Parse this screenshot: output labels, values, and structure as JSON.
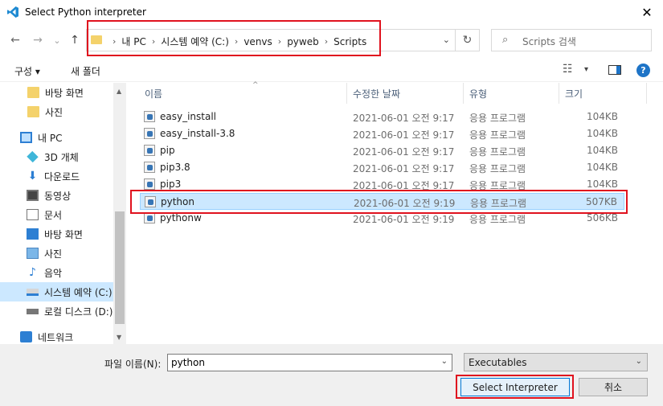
{
  "window": {
    "title": "Select Python interpreter",
    "close_glyph": "✕"
  },
  "nav": {
    "back": "←",
    "forward": "→",
    "recent": "⌄",
    "up": "↑"
  },
  "address": {
    "segments": [
      "내 PC",
      "시스템 예약 (C:)",
      "venvs",
      "pyweb",
      "Scripts"
    ],
    "separator": "›",
    "dropdown": "⌄",
    "refresh": "↻"
  },
  "search": {
    "placeholder": "Scripts 검색",
    "icon": "⌕"
  },
  "toolbar": {
    "organize": "구성 ▾",
    "new_folder": "새 폴더",
    "view_glyph": "☷",
    "view_dd": "▾",
    "help": "?"
  },
  "sidebar": {
    "items": [
      {
        "label": "바탕 화면",
        "icon": "folder"
      },
      {
        "label": "사진",
        "icon": "folder"
      },
      {
        "label": "내 PC",
        "icon": "pc"
      },
      {
        "label": "3D 개체",
        "icon": "3d"
      },
      {
        "label": "다운로드",
        "icon": "download"
      },
      {
        "label": "동영상",
        "icon": "video"
      },
      {
        "label": "문서",
        "icon": "document"
      },
      {
        "label": "바탕 화면",
        "icon": "desktop"
      },
      {
        "label": "사진",
        "icon": "pictures"
      },
      {
        "label": "음악",
        "icon": "music"
      },
      {
        "label": "시스템 예약 (C:)",
        "icon": "drive"
      },
      {
        "label": "로컬 디스크 (D:)",
        "icon": "drive2"
      },
      {
        "label": "네트워크",
        "icon": "network"
      }
    ]
  },
  "columns": {
    "name": "이름",
    "date": "수정한 날짜",
    "type": "유형",
    "size": "크기",
    "sort_arrow": "^"
  },
  "files": [
    {
      "name": "easy_install",
      "date": "2021-06-01 오전 9:17",
      "type": "응용 프로그램",
      "size": "104KB"
    },
    {
      "name": "easy_install-3.8",
      "date": "2021-06-01 오전 9:17",
      "type": "응용 프로그램",
      "size": "104KB"
    },
    {
      "name": "pip",
      "date": "2021-06-01 오전 9:17",
      "type": "응용 프로그램",
      "size": "104KB"
    },
    {
      "name": "pip3.8",
      "date": "2021-06-01 오전 9:17",
      "type": "응용 프로그램",
      "size": "104KB"
    },
    {
      "name": "pip3",
      "date": "2021-06-01 오전 9:17",
      "type": "응용 프로그램",
      "size": "104KB"
    },
    {
      "name": "python",
      "date": "2021-06-01 오전 9:19",
      "type": "응용 프로그램",
      "size": "507KB"
    },
    {
      "name": "pythonw",
      "date": "2021-06-01 오전 9:19",
      "type": "응용 프로그램",
      "size": "506KB"
    }
  ],
  "bottom": {
    "filename_label": "파일 이름(N):",
    "filename_value": "python",
    "filetype": "Executables",
    "select_button": "Select Interpreter",
    "cancel_button": "취소",
    "dd": "⌄"
  },
  "colors": {
    "highlight": "#e0121e",
    "selection": "#cce8ff",
    "accent": "#0078d7"
  }
}
